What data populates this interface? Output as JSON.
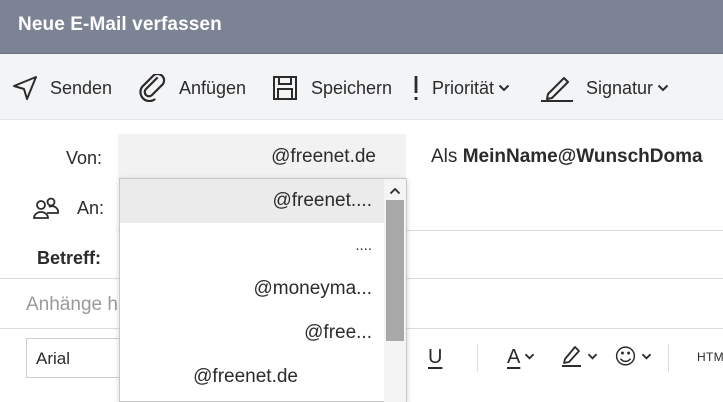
{
  "window": {
    "title": "Neue E-Mail verfassen"
  },
  "toolbar": {
    "send_label": "Senden",
    "attach_label": "Anfügen",
    "save_label": "Speichern",
    "priority_label": "Priorität",
    "signature_label": "Signatur"
  },
  "compose": {
    "from_label": "Von:",
    "from_value": "@freenet.de",
    "as_prefix": "Als",
    "as_value": "MeinName@WunschDoma",
    "to_label": "An:",
    "subject_label": "Betreff:",
    "attachments_label": "Anhänge h"
  },
  "from_dropdown": {
    "options": [
      {
        "label": "@freenet....",
        "selected": true
      },
      {
        "label": "....",
        "selected": false
      },
      {
        "label": "@moneyma...",
        "selected": false
      },
      {
        "label": "@free...",
        "selected": false
      },
      {
        "label": "@freenet.de",
        "selected": false
      }
    ]
  },
  "format_bar": {
    "font_value": "Arial",
    "underline_glyph": "U",
    "font_color_glyph": "A",
    "emoji_glyph": "☺",
    "html_label": "HTM"
  },
  "colors": {
    "titlebar": "#7c8394",
    "toolbar_bg": "#f3f4f6",
    "selected_option": "#ebebeb",
    "scroll_thumb": "#a8a8a8"
  }
}
